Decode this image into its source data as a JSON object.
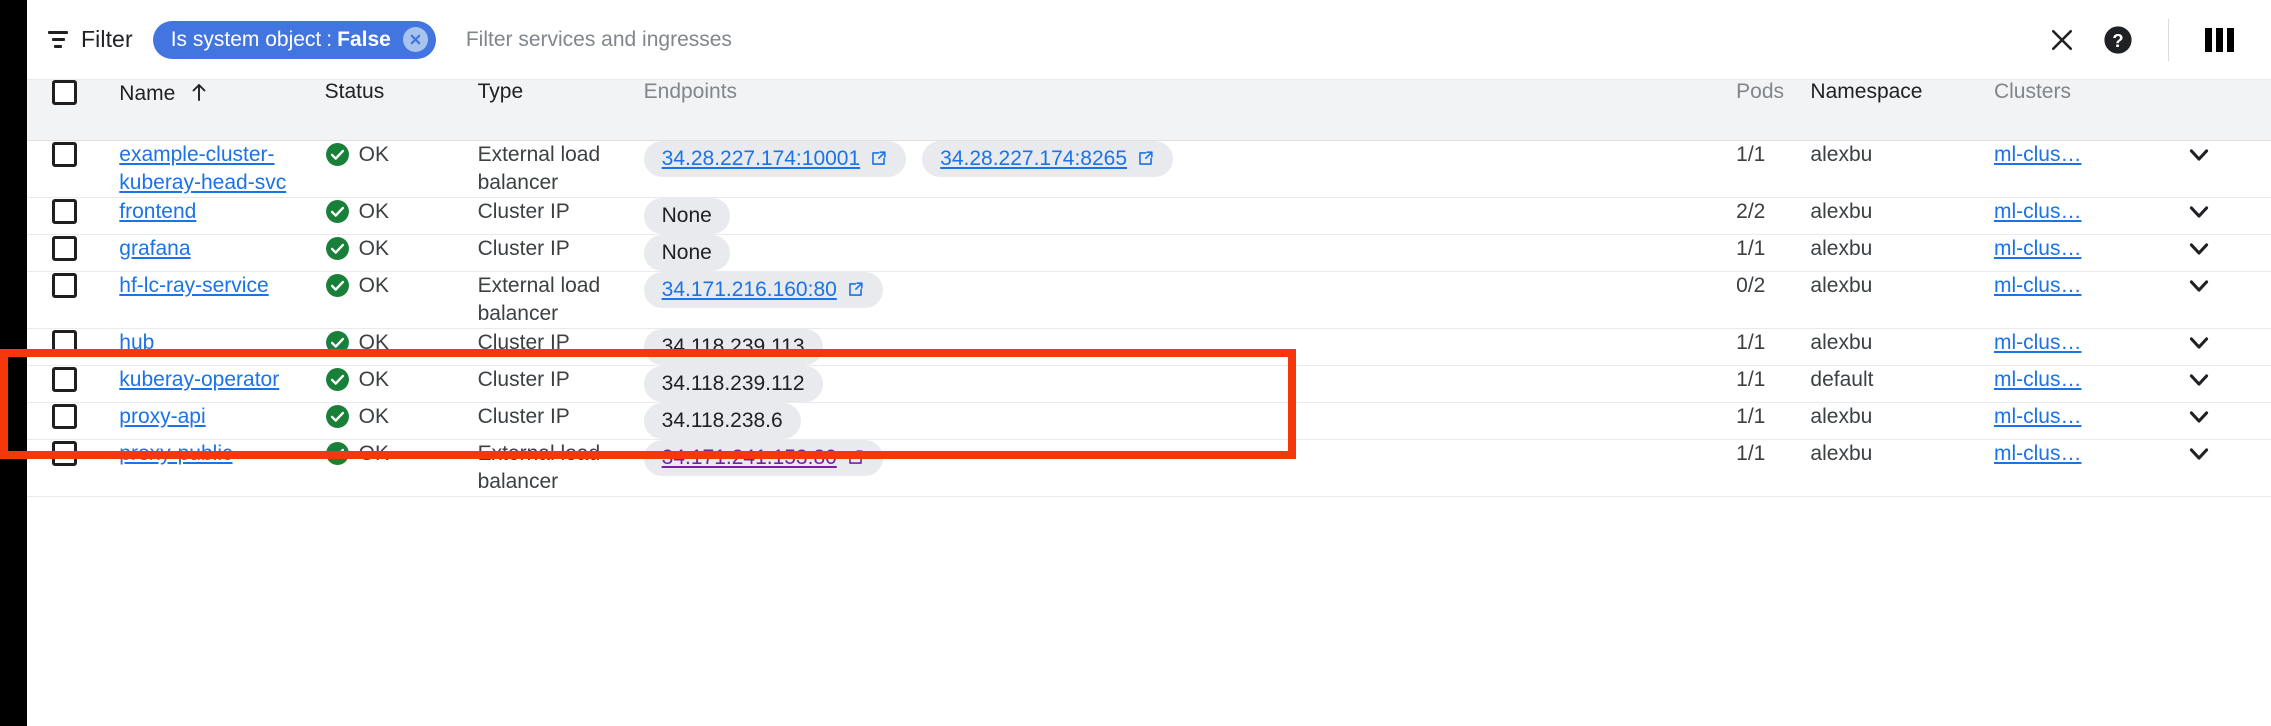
{
  "toolbar": {
    "filter_label": "Filter",
    "filter_icon": "filter-icon",
    "chip": {
      "key": "Is system object",
      "separator": ":",
      "value": "False",
      "remove_icon": "chip-close-icon"
    },
    "search_placeholder": "Filter services and ingresses",
    "search_value": "",
    "close_icon": "close-icon",
    "help_icon": "help-icon",
    "columns_icon": "column-display-options-icon"
  },
  "colors": {
    "accent_blue": "#1a73e8",
    "chip_blue": "#4275e0",
    "status_green": "#188038",
    "highlight_orange": "#f4380c",
    "visited_purple": "#7b1fa2"
  },
  "table": {
    "headers": {
      "select_all": "select-all-checkbox",
      "name": "Name",
      "sort_indicator": "ascending",
      "status": "Status",
      "type": "Type",
      "endpoints": "Endpoints",
      "pods": "Pods",
      "namespace": "Namespace",
      "clusters": "Clusters"
    },
    "rows": [
      {
        "name": "example-cluster-kuberay-head-svc",
        "status": "OK",
        "type": "External load balancer",
        "endpoints": [
          {
            "text": "34.28.227.174:10001",
            "link": true,
            "visited": false
          },
          {
            "text": "34.28.227.174:8265",
            "link": true,
            "visited": false
          }
        ],
        "pods": "1/1",
        "namespace": "alexbu",
        "clusters": "ml-clus…",
        "highlighted": false
      },
      {
        "name": "frontend",
        "status": "OK",
        "type": "Cluster IP",
        "endpoints": [
          {
            "text": "None",
            "link": false,
            "visited": false
          }
        ],
        "pods": "2/2",
        "namespace": "alexbu",
        "clusters": "ml-clus…",
        "highlighted": false
      },
      {
        "name": "grafana",
        "status": "OK",
        "type": "Cluster IP",
        "endpoints": [
          {
            "text": "None",
            "link": false,
            "visited": false
          }
        ],
        "pods": "1/1",
        "namespace": "alexbu",
        "clusters": "ml-clus…",
        "highlighted": false
      },
      {
        "name": "hf-lc-ray-service",
        "status": "OK",
        "type": "External load balancer",
        "endpoints": [
          {
            "text": "34.171.216.160:80",
            "link": true,
            "visited": false
          }
        ],
        "pods": "0/2",
        "namespace": "alexbu",
        "clusters": "ml-clus…",
        "highlighted": true
      },
      {
        "name": "hub",
        "status": "OK",
        "type": "Cluster IP",
        "endpoints": [
          {
            "text": "34.118.239.113",
            "link": false,
            "visited": false
          }
        ],
        "pods": "1/1",
        "namespace": "alexbu",
        "clusters": "ml-clus…",
        "highlighted": false
      },
      {
        "name": "kuberay-operator",
        "status": "OK",
        "type": "Cluster IP",
        "endpoints": [
          {
            "text": "34.118.239.112",
            "link": false,
            "visited": false
          }
        ],
        "pods": "1/1",
        "namespace": "default",
        "clusters": "ml-clus…",
        "highlighted": false
      },
      {
        "name": "proxy-api",
        "status": "OK",
        "type": "Cluster IP",
        "endpoints": [
          {
            "text": "34.118.238.6",
            "link": false,
            "visited": false
          }
        ],
        "pods": "1/1",
        "namespace": "alexbu",
        "clusters": "ml-clus…",
        "highlighted": false
      },
      {
        "name": "proxy-public",
        "status": "OK",
        "type": "External load balancer",
        "endpoints": [
          {
            "text": "34.171.241.153:80",
            "link": true,
            "visited": true
          }
        ],
        "pods": "1/1",
        "namespace": "alexbu",
        "clusters": "ml-clus…",
        "highlighted": false
      }
    ]
  }
}
